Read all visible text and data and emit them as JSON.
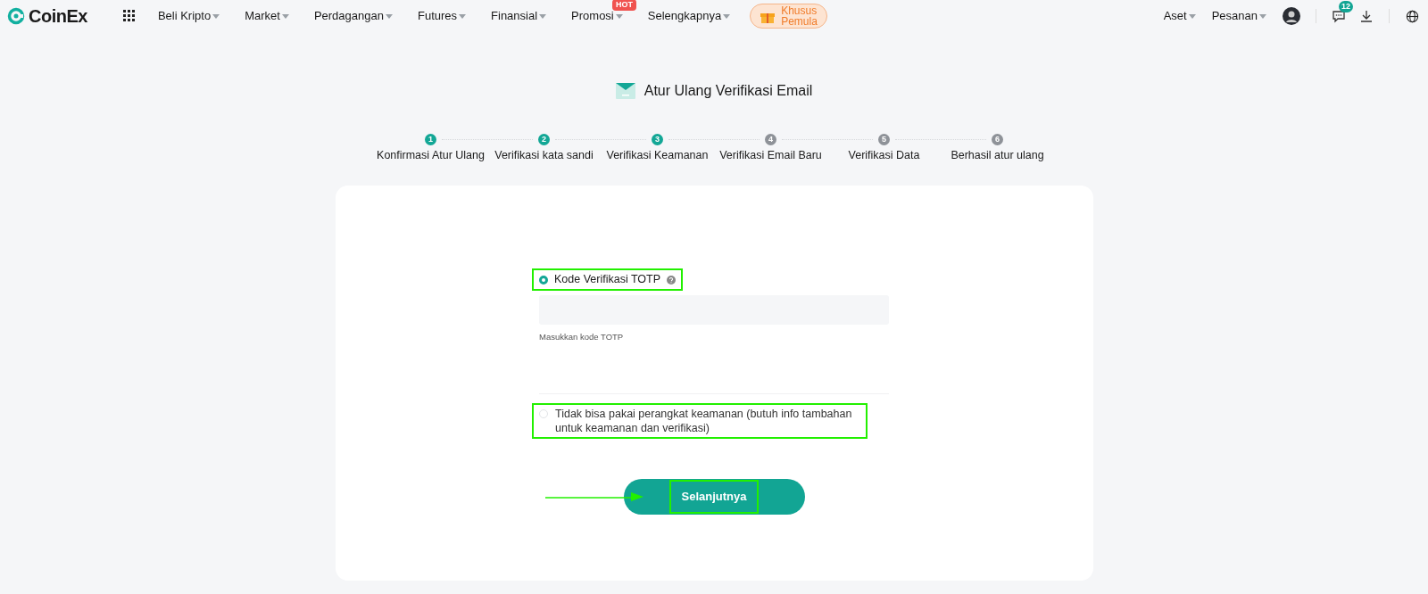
{
  "nav": {
    "logo": "CoinEx",
    "menu": [
      {
        "label": "Beli Kripto"
      },
      {
        "label": "Market"
      },
      {
        "label": "Perdagangan"
      },
      {
        "label": "Futures"
      },
      {
        "label": "Finansial"
      },
      {
        "label": "Promosi",
        "badge": "HOT"
      },
      {
        "label": "Selengkapnya"
      }
    ],
    "promo": [
      "Khusus",
      "Pemula"
    ],
    "right_menu": [
      "Aset",
      "Pesanan"
    ],
    "message_count": "12"
  },
  "title": "Atur Ulang Verifikasi Email",
  "steps": [
    {
      "number": "1",
      "label": "Konfirmasi Atur Ulang",
      "completed": true
    },
    {
      "number": "2",
      "label": "Verifikasi kata sandi",
      "completed": true
    },
    {
      "number": "3",
      "label": "Verifikasi Keamanan",
      "completed": true
    },
    {
      "number": "4",
      "label": "Verifikasi Email Baru",
      "completed": false
    },
    {
      "number": "5",
      "label": "Verifikasi Data",
      "completed": false
    },
    {
      "number": "6",
      "label": "Berhasil atur ulang",
      "completed": false
    }
  ],
  "options": [
    {
      "kind": "field",
      "label": "Kode Verifikasi TOTP",
      "selected": true,
      "highlighted": true,
      "hint": "Masukkan kode TOTP"
    },
    {
      "kind": "plain",
      "label": "Tidak bisa pakai perangkat keamanan (butuh info tambahan untuk keamanan dan verifikasi)",
      "selected": false,
      "highlighted": true
    }
  ],
  "next_button": {
    "label": "Selanjutnya",
    "highlighted": true,
    "pointer_arrow": true
  }
}
